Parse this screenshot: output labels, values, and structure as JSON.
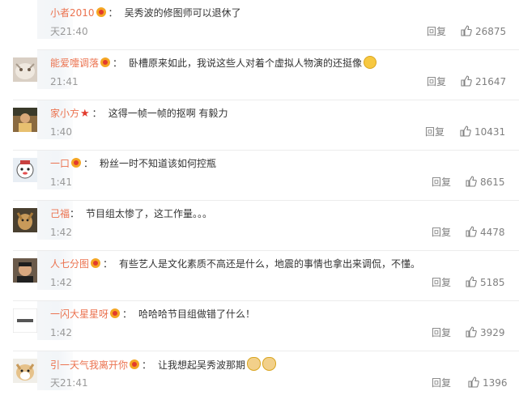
{
  "comments": [
    {
      "user": "小者2010",
      "badge": "vip",
      "text": "吴秀波的修图师可以退休了",
      "time": "天21:40",
      "reply": "回复",
      "likes": "26875",
      "avatar": "none",
      "emoji": ""
    },
    {
      "user": "能爱嚏调落",
      "badge": "vip",
      "text": "卧槽原来如此，我说这些人对着个虚拟人物演的还挺像",
      "time": "21:41",
      "reply": "回复",
      "likes": "21647",
      "avatar": "cat",
      "emoji": "laugh"
    },
    {
      "user": "家小方",
      "badge": "star",
      "text": "这得一帧一帧的抠啊 有毅力",
      "time": "1:40",
      "reply": "回复",
      "likes": "10431",
      "avatar": "person",
      "emoji": ""
    },
    {
      "user": "一口",
      "badge": "vip",
      "text": "粉丝一时不知道该如何控瓶",
      "time": "1:41",
      "reply": "回复",
      "likes": "8615",
      "avatar": "cartoon",
      "emoji": ""
    },
    {
      "user": "己福",
      "badge": "",
      "text": "节目组太惨了，这工作量。。。",
      "time": "1:42",
      "reply": "回复",
      "likes": "4478",
      "avatar": "dog",
      "emoji": ""
    },
    {
      "user": "人七分图",
      "badge": "vip",
      "text": "有些艺人是文化素质不高还是什么，地震的事情也拿出来调侃，不懂。",
      "time": "1:42",
      "reply": "回复",
      "likes": "5185",
      "avatar": "man",
      "emoji": ""
    },
    {
      "user": "一闪大星星呀",
      "badge": "vip",
      "text": "哈哈哈节目组做错了什么！",
      "time": "1:42",
      "reply": "回复",
      "likes": "3929",
      "avatar": "logo",
      "emoji": ""
    },
    {
      "user": "引一天气我离开你",
      "badge": "vip",
      "text": "让我想起吴秀波那期",
      "time": "天21:41",
      "reply": "回复",
      "likes": "1396",
      "avatar": "shiba",
      "emoji": "doge2"
    }
  ],
  "icons": {
    "like": "thumbs-up-icon",
    "vip": "crown-badge-icon",
    "star": "star-badge-icon"
  },
  "colors": {
    "username": "#eb7350",
    "meta": "#999999"
  }
}
